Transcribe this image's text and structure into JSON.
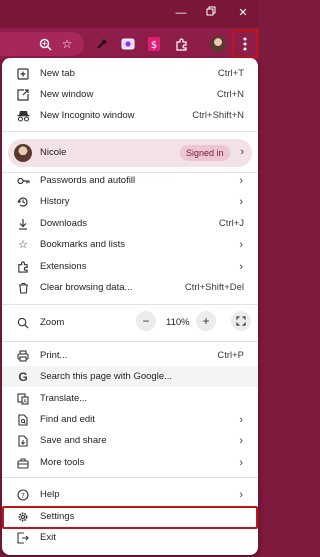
{
  "window": {
    "minimize_icon": "minimize-icon",
    "restore_icon": "restore-icon",
    "close_icon": "close-icon"
  },
  "toolbar": {
    "icons": [
      "zoom-icon",
      "bookmark-star-icon",
      "eyedropper-icon",
      "screen-cast-icon",
      "dollar-extension-icon",
      "extensions-puzzle-icon",
      "profile-avatar-icon",
      "more-menu-icon"
    ]
  },
  "menu": {
    "new_tab": {
      "label": "New tab",
      "shortcut": "Ctrl+T"
    },
    "new_window": {
      "label": "New window",
      "shortcut": "Ctrl+N"
    },
    "new_incognito": {
      "label": "New Incognito window",
      "shortcut": "Ctrl+Shift+N"
    },
    "profile": {
      "name": "Nicole",
      "status": "Signed in"
    },
    "passwords": {
      "label": "Passwords and autofill"
    },
    "history": {
      "label": "History"
    },
    "downloads": {
      "label": "Downloads",
      "shortcut": "Ctrl+J"
    },
    "bookmarks": {
      "label": "Bookmarks and lists"
    },
    "extensions": {
      "label": "Extensions"
    },
    "clear_data": {
      "label": "Clear browsing data...",
      "shortcut": "Ctrl+Shift+Del"
    },
    "zoom": {
      "label": "Zoom",
      "value": "110%"
    },
    "print": {
      "label": "Print...",
      "shortcut": "Ctrl+P"
    },
    "search_page": {
      "label": "Search this page with Google..."
    },
    "translate": {
      "label": "Translate..."
    },
    "find_edit": {
      "label": "Find and edit"
    },
    "save_share": {
      "label": "Save and share"
    },
    "more_tools": {
      "label": "More tools"
    },
    "help": {
      "label": "Help"
    },
    "settings": {
      "label": "Settings"
    },
    "exit": {
      "label": "Exit"
    }
  },
  "colors": {
    "frame": "#7a1739",
    "toolbar": "#8f1d4a",
    "highlight_box": "#c0141b",
    "profile_bg": "#f3e1e8"
  }
}
